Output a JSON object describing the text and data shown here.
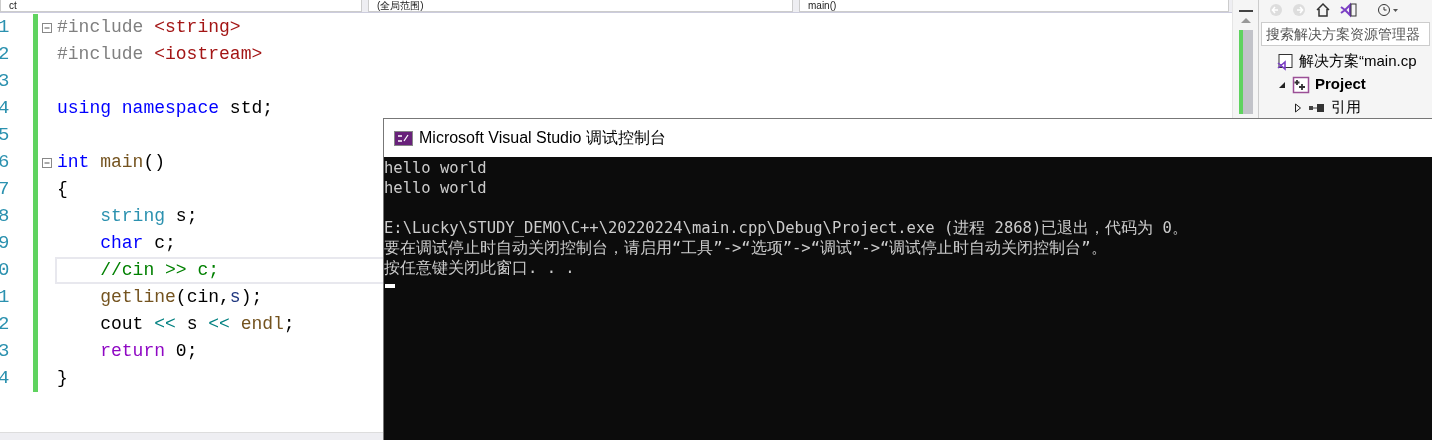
{
  "nav_bar": {
    "dropdowns": [
      "ct",
      "(全局范围)",
      "main()"
    ]
  },
  "editor": {
    "lines": [
      {
        "number": "1",
        "fold": true,
        "current": false,
        "tokens": [
          {
            "kind": "preproc",
            "text": "#include "
          },
          {
            "kind": "include",
            "text": "<string>"
          }
        ]
      },
      {
        "number": "2",
        "fold": false,
        "current": false,
        "tokens": [
          {
            "kind": "preproc",
            "text": "#include "
          },
          {
            "kind": "include",
            "text": "<iostream>"
          }
        ]
      },
      {
        "number": "3",
        "fold": false,
        "current": false
      },
      {
        "number": "4",
        "fold": false,
        "current": false,
        "tokens": [
          {
            "kind": "keyword",
            "text": "using namespace"
          },
          {
            "kind": "plain",
            "text": " std;"
          }
        ]
      },
      {
        "number": "5",
        "fold": false,
        "current": false
      },
      {
        "number": "6",
        "fold": true,
        "current": false,
        "tokens": [
          {
            "kind": "keyword",
            "text": "int "
          },
          {
            "kind": "function",
            "text": "main"
          },
          {
            "kind": "plain",
            "text": "()"
          }
        ]
      },
      {
        "number": "7",
        "fold": false,
        "current": false,
        "tokens": [
          {
            "kind": "plain",
            "text": "{"
          }
        ]
      },
      {
        "number": "8",
        "fold": false,
        "current": false,
        "tokens": [
          {
            "kind": "type",
            "text": "    string"
          },
          {
            "kind": "plain",
            "text": " s;"
          }
        ]
      },
      {
        "number": "9",
        "fold": false,
        "current": false,
        "tokens": [
          {
            "kind": "keyword",
            "text": "    char"
          },
          {
            "kind": "plain",
            "text": " c;"
          }
        ]
      },
      {
        "number": "0",
        "fold": false,
        "current": true,
        "tokens": [
          {
            "kind": "comment",
            "text": "    //cin >> c;"
          }
        ]
      },
      {
        "number": "1",
        "fold": false,
        "current": false,
        "tokens": [
          {
            "kind": "function",
            "text": "    getline"
          },
          {
            "kind": "plain",
            "text": "(cin,"
          },
          {
            "kind": "param",
            "text": "s"
          },
          {
            "kind": "plain",
            "text": ");"
          }
        ]
      },
      {
        "number": "2",
        "fold": false,
        "current": false,
        "tokens": [
          {
            "kind": "plain",
            "text": "    cout "
          },
          {
            "kind": "operator",
            "text": "<<"
          },
          {
            "kind": "plain",
            "text": " s "
          },
          {
            "kind": "operator",
            "text": "<<"
          },
          {
            "kind": "function",
            "text": " endl"
          },
          {
            "kind": "plain",
            "text": ";"
          }
        ]
      },
      {
        "number": "3",
        "fold": false,
        "current": false,
        "tokens": [
          {
            "kind": "control",
            "text": "    return"
          },
          {
            "kind": "plain",
            "text": " 0;"
          }
        ]
      },
      {
        "number": "4",
        "fold": false,
        "current": false,
        "tokens": [
          {
            "kind": "plain",
            "text": "}"
          }
        ]
      }
    ]
  },
  "solution_explorer": {
    "search": {
      "placeholder": "搜索解决方案资源管理器"
    },
    "tree": [
      {
        "label": "解决方案“main.cp",
        "kind": "solution",
        "children": [
          {
            "label": "Project",
            "kind": "project",
            "expanded": true,
            "children": [
              {
                "label": "引用",
                "kind": "references",
                "expanded": false
              }
            ]
          }
        ]
      }
    ]
  },
  "console": {
    "title": "Microsoft Visual Studio 调试控制台",
    "blocks": [
      [
        "hello world",
        "hello world"
      ],
      [
        "E:\\Lucky\\STUDY_DEMO\\C++\\20220224\\main.cpp\\Debug\\Project.exe (进程 2868)已退出，代码为 0。",
        "要在调试停止时自动关闭控制台，请启用“工具”->“选项”->“调试”->“调试停止时自动关闭控制台”。",
        "按任意键关闭此窗口. . ."
      ]
    ]
  }
}
